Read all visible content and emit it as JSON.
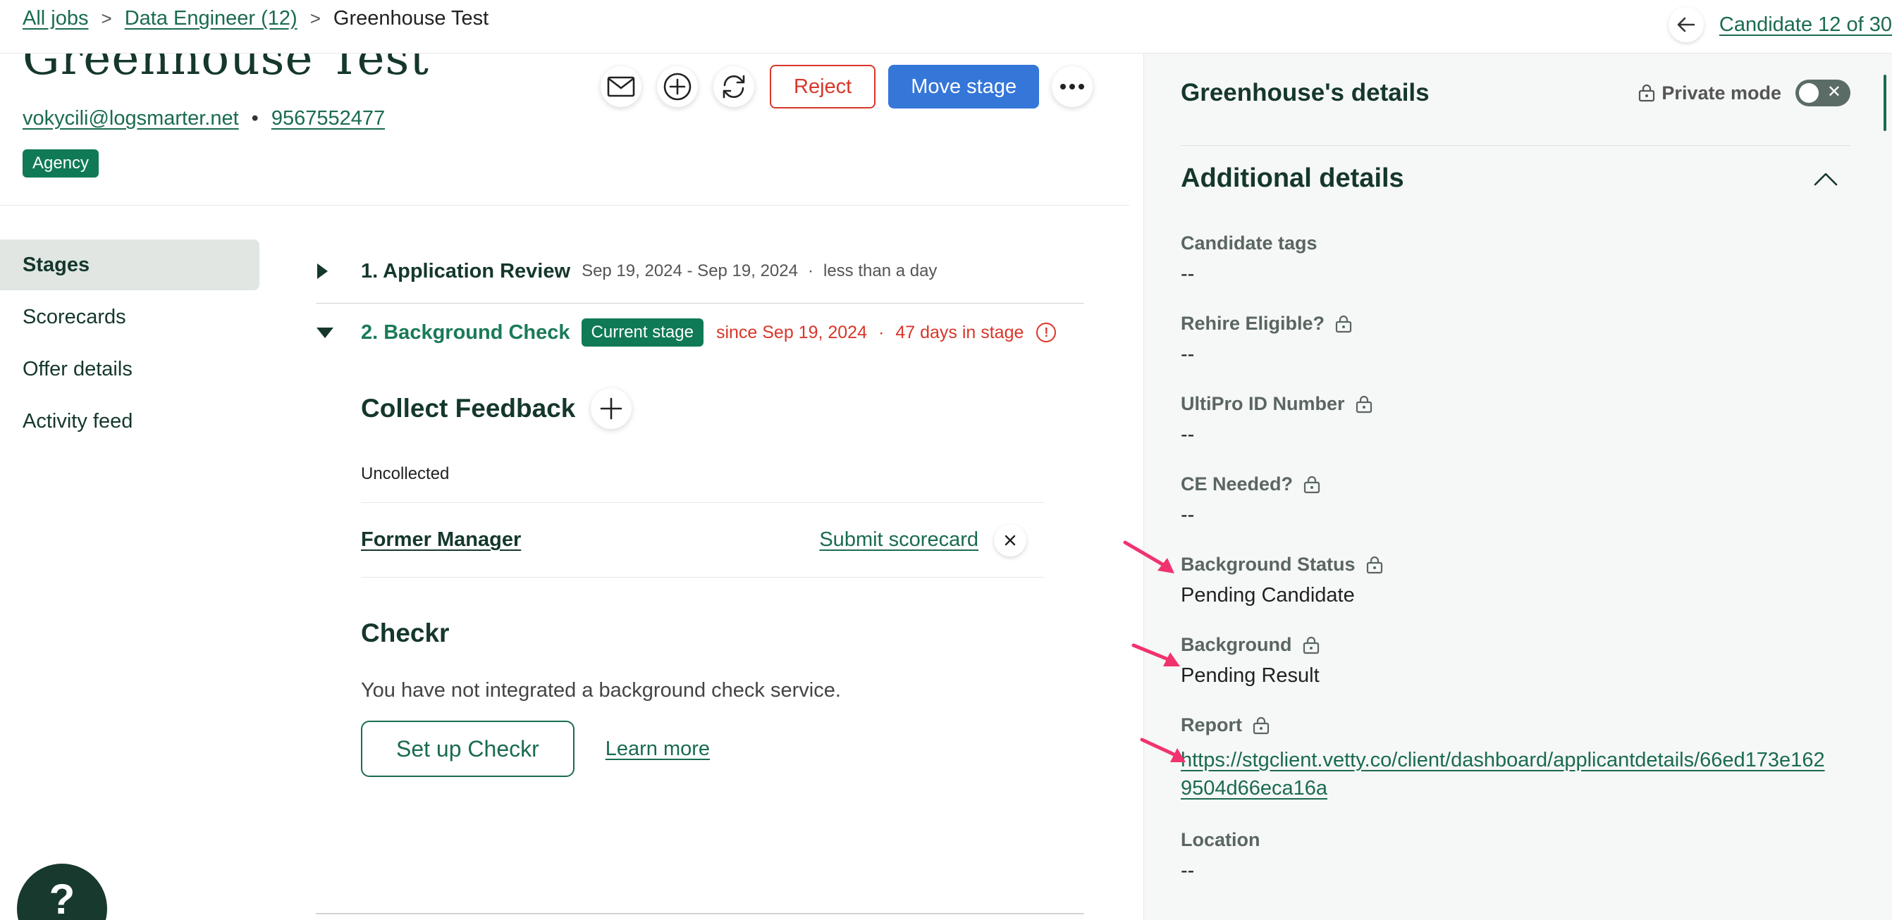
{
  "breadcrumb": {
    "all_jobs": "All jobs",
    "job": "Data Engineer (12)",
    "current": "Greenhouse Test",
    "separator": ">"
  },
  "candidate_nav": {
    "label": "Candidate 12 of 30"
  },
  "candidate": {
    "name": "Greenhouse Test",
    "email": "vokycili@logsmarter.net",
    "phone": "9567552477",
    "dot": "•",
    "source_badge": "Agency"
  },
  "actions": {
    "reject": "Reject",
    "move_stage": "Move stage"
  },
  "left_nav": {
    "items": [
      {
        "label": "Stages",
        "active": true
      },
      {
        "label": "Scorecards"
      },
      {
        "label": "Offer details"
      },
      {
        "label": "Activity feed"
      }
    ]
  },
  "stages": {
    "stage1": {
      "title": "1. Application Review",
      "dates": "Sep 19, 2024 - Sep 19, 2024",
      "duration": "less than a day"
    },
    "stage2": {
      "title": "2. Background Check",
      "badge": "Current stage",
      "since": "since Sep 19, 2024",
      "days": "47 days in stage"
    },
    "dot": "·"
  },
  "feedback": {
    "title": "Collect Feedback",
    "status": "Uncollected",
    "interviewer": "Former Manager",
    "submit": "Submit scorecard"
  },
  "checkr": {
    "title": "Checkr",
    "text": "You have not integrated a background check service.",
    "setup": "Set up Checkr",
    "learn": "Learn more"
  },
  "help": {
    "label": "?"
  },
  "details_panel": {
    "title": "Greenhouse's details",
    "private_mode": "Private mode",
    "section": "Additional details",
    "fields": [
      {
        "label": "Candidate tags",
        "value": "--"
      },
      {
        "label": "Rehire Eligible?",
        "value": "--"
      },
      {
        "label": "UltiPro ID Number",
        "value": "--"
      },
      {
        "label": "CE Needed?",
        "value": "--"
      },
      {
        "label": "Background Status",
        "value": "Pending Candidate"
      },
      {
        "label": "Background",
        "value": "Pending Result"
      },
      {
        "label": "Report",
        "value": "https://stgclient.vetty.co/client/dashboard/applicantdetails/66ed173e1629504d66eca16a"
      },
      {
        "label": "Location",
        "value": "--"
      }
    ]
  },
  "colors": {
    "brand_green": "#1a6b4f",
    "badge_green": "#0f7a55",
    "danger_red": "#d9362a",
    "primary_blue": "#3576d9",
    "annotation_pink": "#f0336e"
  },
  "icons": [
    "arrow-left-icon",
    "mail-icon",
    "plus-circle-icon",
    "refresh-icon",
    "more-horizontal-icon",
    "triangle-right-icon",
    "triangle-down-icon",
    "alert-circle-icon",
    "plus-icon",
    "close-icon",
    "help-icon",
    "lock-icon",
    "chevron-up-icon",
    "toggle-x-icon",
    "annotation-arrow-icon"
  ]
}
